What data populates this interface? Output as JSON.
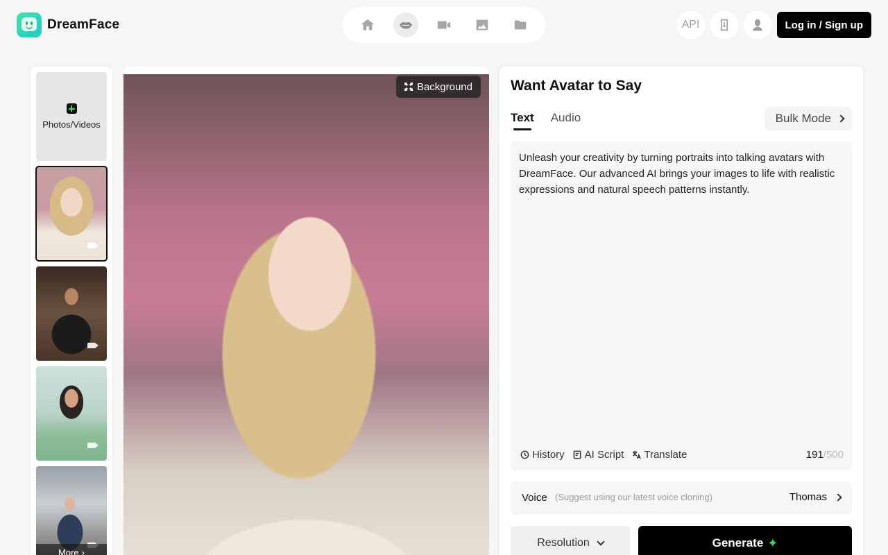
{
  "app": {
    "name": "DreamFace"
  },
  "nav": {
    "items": [
      {
        "name": "home",
        "icon": "home-icon"
      },
      {
        "name": "lip-sync",
        "icon": "lips-icon",
        "active": true
      },
      {
        "name": "video",
        "icon": "video-camera-icon"
      },
      {
        "name": "image",
        "icon": "image-icon"
      },
      {
        "name": "folder",
        "icon": "folder-icon"
      }
    ]
  },
  "header": {
    "api_label": "API",
    "download_icon": "download-app-icon",
    "avatar_icon": "user-avatar-icon",
    "login_label": "Log in / Sign up"
  },
  "sidebar": {
    "upload_label": "Photos/Videos",
    "more_label": "More",
    "thumbnails": [
      {
        "label": "blonde-woman-video",
        "selected": true
      },
      {
        "label": "man-black-shirt-video"
      },
      {
        "label": "woman-green-top-video"
      },
      {
        "label": "woman-in-car-video"
      }
    ]
  },
  "preview": {
    "background_label": "Background"
  },
  "panel": {
    "title": "Want Avatar to Say",
    "tabs": [
      {
        "label": "Text",
        "active": true
      },
      {
        "label": "Audio"
      }
    ],
    "bulk_label": "Bulk Mode",
    "script_text": "Unleash your creativity by turning portraits into talking avatars with DreamFace. Our advanced AI brings your images to life with realistic expressions and natural speech patterns instantly.",
    "tools": {
      "history": "History",
      "ai_script": "AI Script",
      "translate": "Translate"
    },
    "char_count": "191",
    "char_max": "/500",
    "voice_label": "Voice",
    "voice_hint": "(Suggest using our latest voice cloning)",
    "voice_value": "Thomas",
    "resolution_label": "Resolution",
    "generate_label": "Generate"
  }
}
